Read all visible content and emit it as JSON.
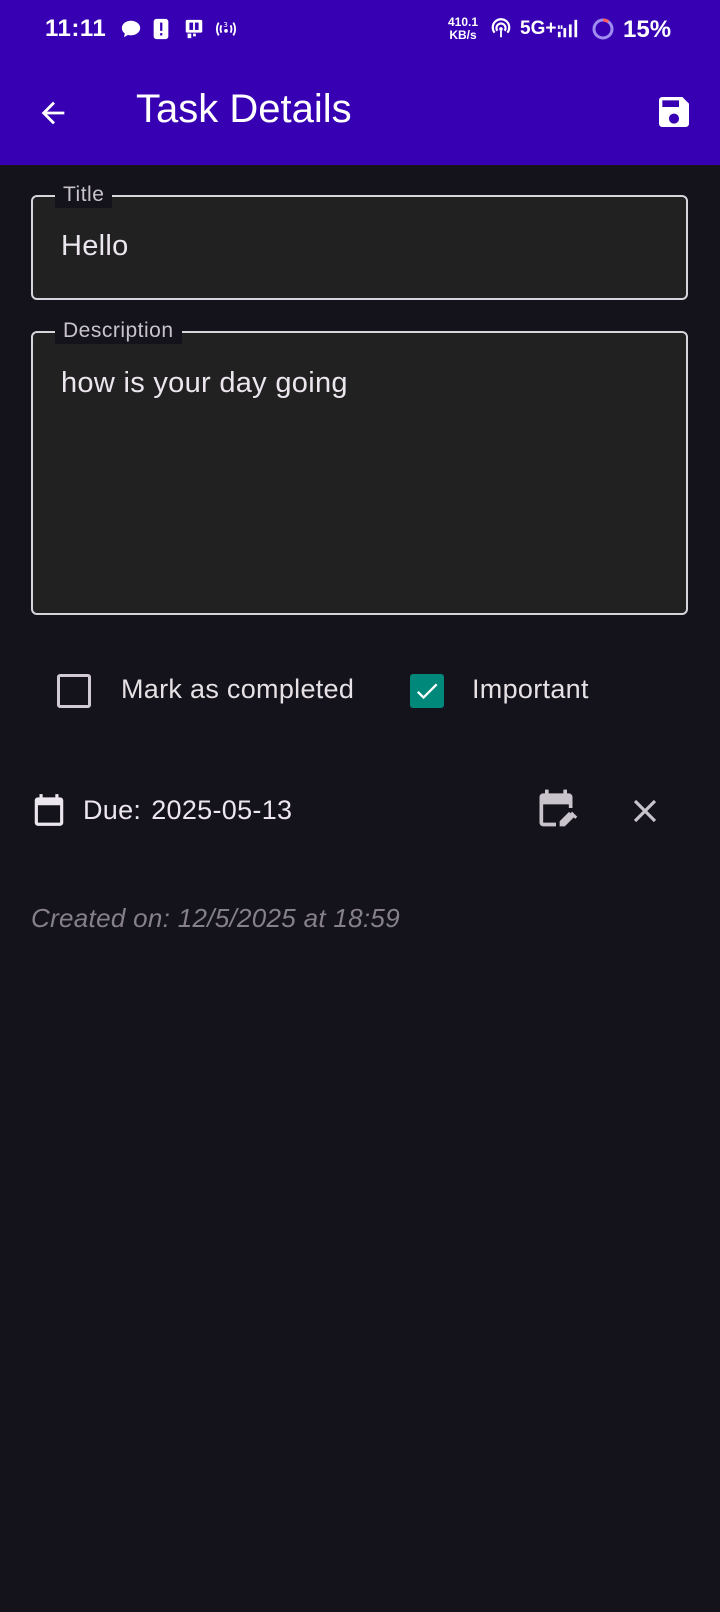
{
  "status_bar": {
    "time": "11:11",
    "net_speed_value": "410.1",
    "net_speed_unit": "KB/s",
    "network_type": "5G+",
    "battery_percent": "15%",
    "icons": [
      "chat-bubble-icon",
      "alert-icon",
      "screen-cast-icon",
      "wireless-3-icon",
      "hotspot-icon",
      "signal-bars-icon",
      "battery-ring-icon"
    ]
  },
  "app_bar": {
    "title": "Task Details",
    "back_icon": "arrow-back-icon",
    "save_icon": "save-icon",
    "background": "#3700b3"
  },
  "form": {
    "title": {
      "label": "Title",
      "value": "Hello"
    },
    "description": {
      "label": "Description",
      "value": "how is your day going"
    },
    "completed": {
      "label": "Mark as completed",
      "checked": false
    },
    "important": {
      "label": "Important",
      "checked": true,
      "color": "#00897b"
    }
  },
  "due": {
    "label": "Due:",
    "value": "2025-05-13",
    "calendar_icon": "calendar-icon",
    "edit_icon": "edit-calendar-icon",
    "clear_icon": "close-icon"
  },
  "created_text": "Created on: 12/5/2025 at 18:59"
}
